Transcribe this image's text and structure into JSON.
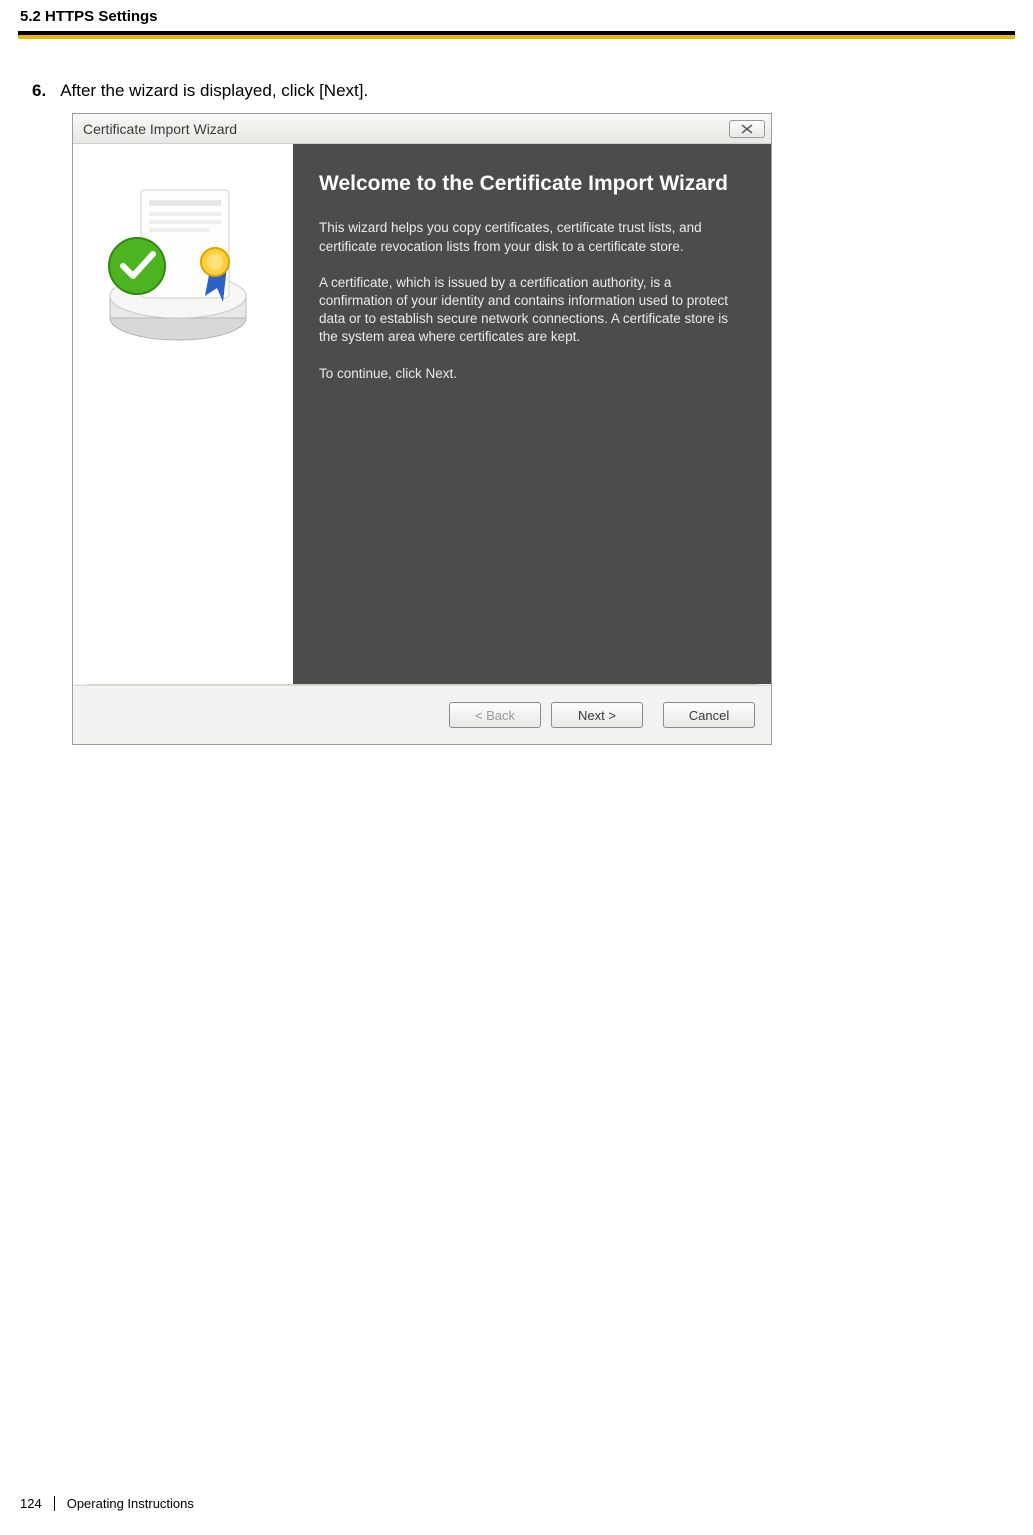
{
  "header": {
    "section": "5.2 HTTPS Settings"
  },
  "step": {
    "number": "6.",
    "text": "After the wizard is displayed, click [Next]."
  },
  "wizard": {
    "titlebar": "Certificate Import Wizard",
    "heading": "Welcome to the Certificate Import Wizard",
    "para1": "This wizard helps you copy certificates, certificate trust lists, and certificate revocation lists from your disk to a certificate store.",
    "para2": "A certificate, which is issued by a certification authority, is a confirmation of your identity and contains information used to protect data or to establish secure network connections. A certificate store is the system area where certificates are kept.",
    "para3": "To continue, click Next.",
    "buttons": {
      "back": "< Back",
      "next": "Next >",
      "cancel": "Cancel"
    }
  },
  "footer": {
    "page": "124",
    "doc": "Operating Instructions"
  }
}
